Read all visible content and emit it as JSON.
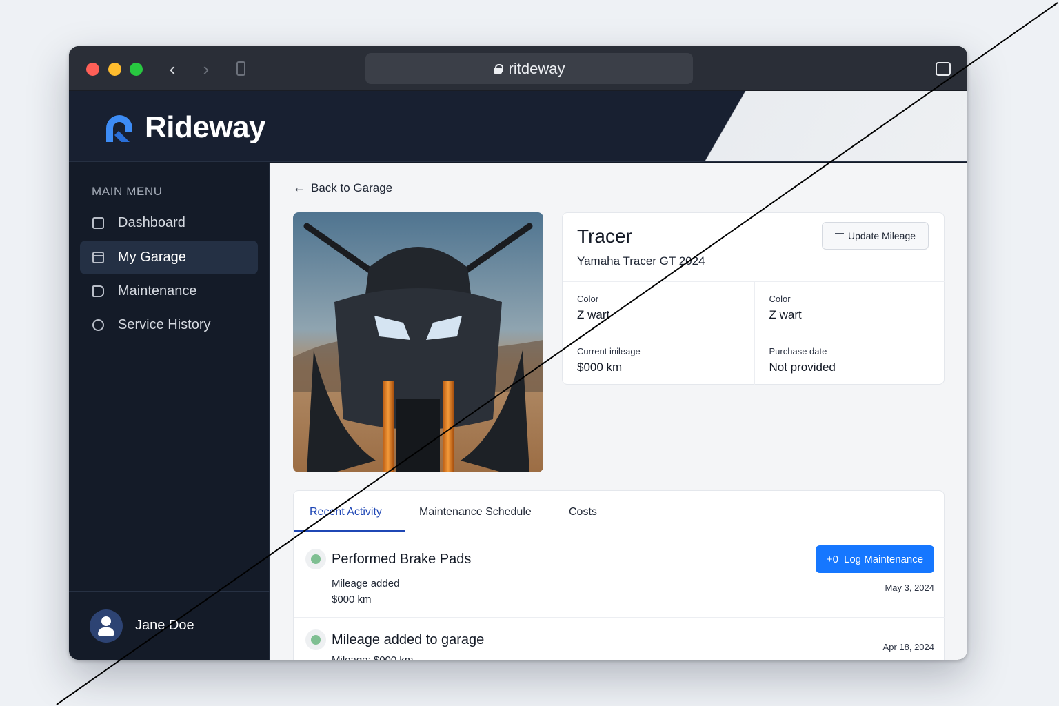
{
  "browser": {
    "url": "ritdeway"
  },
  "app": {
    "brand": "Rideway",
    "accent": "#1677ff"
  },
  "sidebar": {
    "heading": "MAIN MENU",
    "items": [
      {
        "label": "Dashboard",
        "icon": "square-icon"
      },
      {
        "label": "My Garage",
        "icon": "garage-icon",
        "active": true
      },
      {
        "label": "Maintenance",
        "icon": "document-icon"
      },
      {
        "label": "Service History",
        "icon": "history-icon"
      }
    ],
    "user": {
      "name": "Jane Doe"
    }
  },
  "main": {
    "back_link": "Back to Garage",
    "vehicle": {
      "name": "Tracer",
      "model": "Yamaha Tracer GT 2024",
      "update_button": "Update Mileage",
      "details": [
        {
          "label": "Color",
          "value": "Z wart"
        },
        {
          "label": "Color",
          "value": "Z wart"
        },
        {
          "label": "Current inileage",
          "value": "$000 km"
        },
        {
          "label": "Purchase date",
          "value": "Not provided"
        }
      ]
    },
    "tabs": [
      "Recent Activity",
      "Maintenance Schedule",
      "Costs"
    ],
    "active_tab": "Recent Activity",
    "log_button": {
      "prefix": "+0",
      "label": "Log Maintenance"
    },
    "activity": [
      {
        "title": "Performed Brake Pads",
        "lines": [
          "Mileage added",
          "$000 km"
        ],
        "date": "May 3, 2024"
      },
      {
        "title": "Mileage added to garage",
        "lines": [
          "Mileage: $000 km"
        ],
        "date": "Apr 18, 2024"
      }
    ]
  }
}
